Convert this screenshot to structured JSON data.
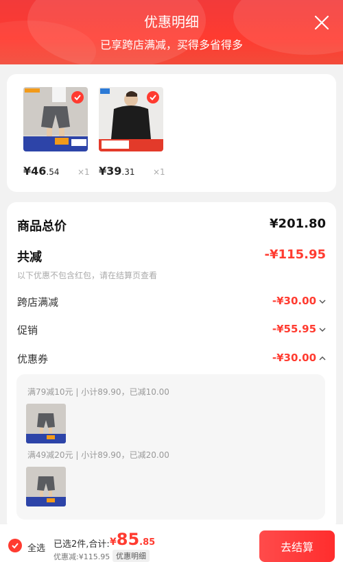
{
  "header": {
    "title": "优惠明细",
    "subtitle": "已享跨店满减，买得多省得多"
  },
  "products": [
    {
      "price_int": "¥46",
      "price_dec": ".54",
      "qty": "×1",
      "label": "shorts"
    },
    {
      "price_int": "¥39",
      "price_dec": ".31",
      "qty": "×1",
      "label": "sweater"
    }
  ],
  "details": {
    "total_label": "商品总价",
    "total_value": "¥201.80",
    "reduce_label": "共减",
    "reduce_value": "-¥115.95",
    "note": "以下优惠不包含红包，请在结算页查看",
    "rows": [
      {
        "label": "跨店满减",
        "value": "-¥30.00",
        "chev": "down"
      },
      {
        "label": "促销",
        "value": "-¥55.95",
        "chev": "down"
      },
      {
        "label": "优惠券",
        "value": "-¥30.00",
        "chev": "up"
      }
    ],
    "coupon_lines": [
      "满79减10元 | 小计89.90，已减10.00",
      "满49减20元 | 小计89.90，已减20.00"
    ]
  },
  "footer": {
    "select_all": "全选",
    "summary": "已选2件,合计:",
    "total_sym": "¥",
    "total_int": "85",
    "total_dec": ".85",
    "discount": "优惠减:¥115.95",
    "detail_tag": "优惠明细",
    "checkout": "去结算"
  },
  "colors": {
    "accent": "#ff3b30",
    "header": "#f23a3a"
  }
}
